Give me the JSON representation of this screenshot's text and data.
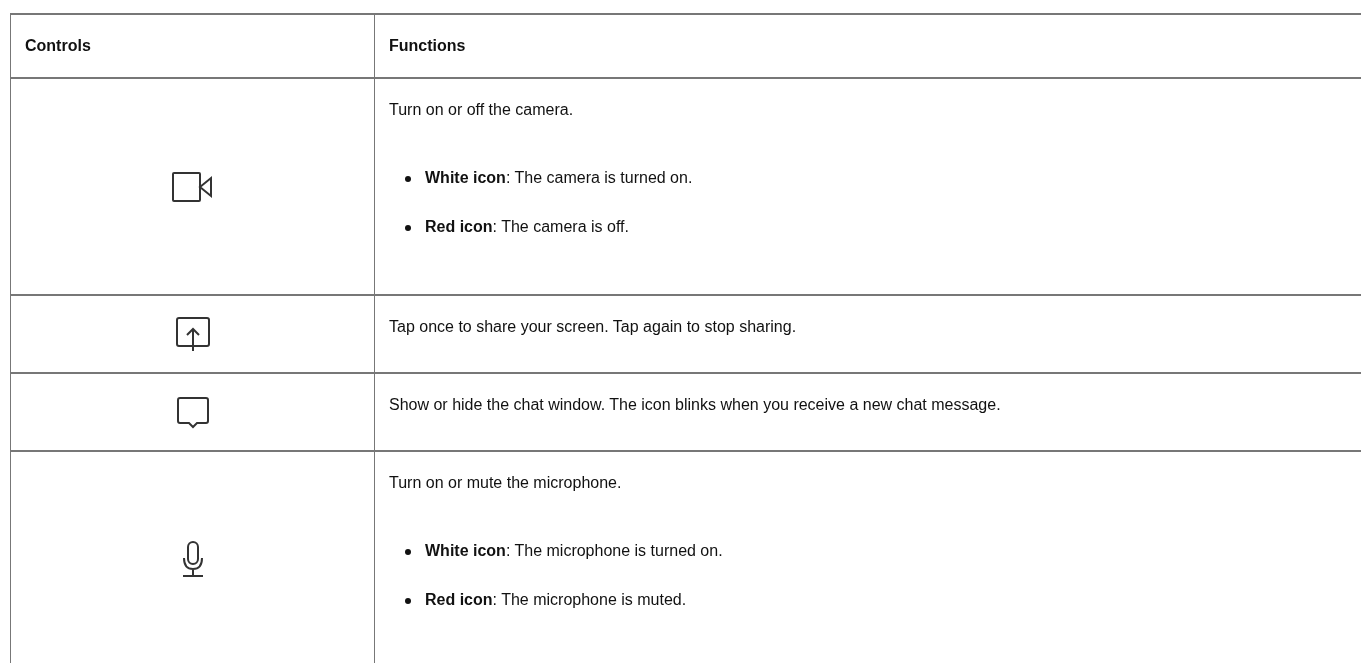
{
  "table": {
    "columns": [
      "Controls",
      "Functions"
    ],
    "rows": [
      {
        "lines": [
          {
            "kind": "paragraph",
            "text": "Turn on or off the camera."
          },
          {
            "kind": "bullet",
            "text": "**White icon**: The camera is turned on."
          },
          {
            "kind": "bullet",
            "text": "**Red icon**: The camera is off."
          }
        ]
      },
      {
        "lines": [
          {
            "kind": "paragraph",
            "text": "Tap once to share your screen. Tap again to stop sharing."
          }
        ]
      },
      {
        "lines": [
          {
            "kind": "paragraph",
            "text": "Show or hide the chat window. The icon blinks when you receive a new chat message."
          }
        ]
      },
      {
        "lines": [
          {
            "kind": "paragraph",
            "text": "Turn on or mute the microphone."
          },
          {
            "kind": "bullet",
            "text": "**White icon**: The microphone is turned on."
          },
          {
            "kind": "bullet",
            "text": "**Red icon**: The microphone is muted."
          }
        ]
      }
    ]
  }
}
